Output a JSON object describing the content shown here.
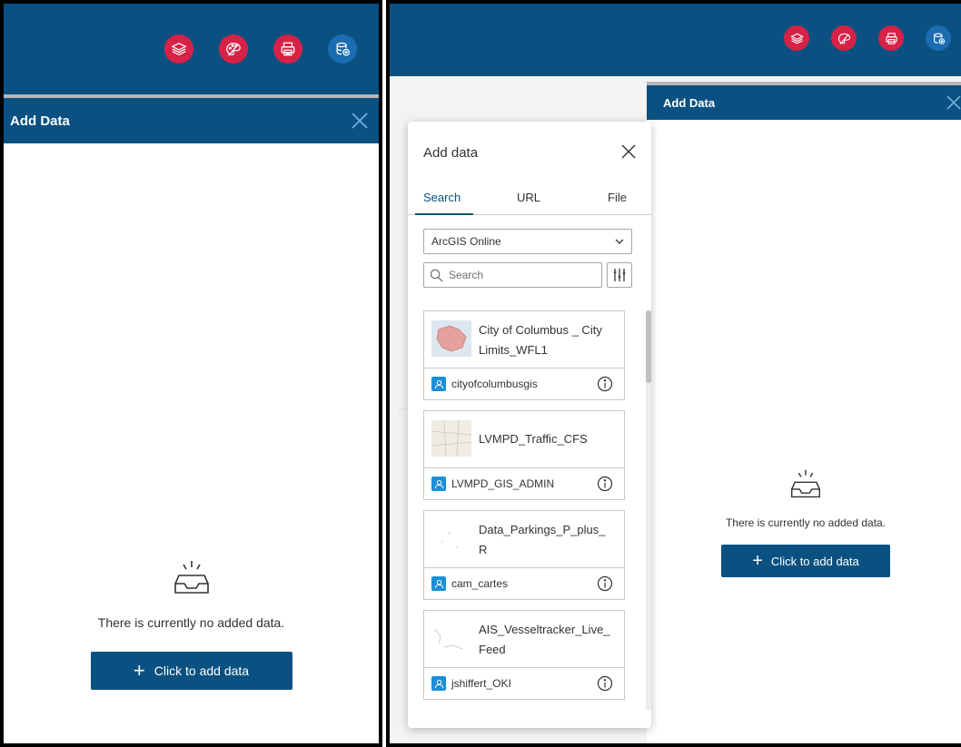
{
  "colors": {
    "header_blue": "#0a5181",
    "tool_red": "#d62246",
    "tool_blue": "#1a6db0",
    "owner_icon_blue": "#1a8fd8",
    "divider_gray": "#b7b7b7"
  },
  "toolbar": {
    "buttons": [
      {
        "icon": "layers-icon",
        "color": "red"
      },
      {
        "icon": "palette-icon",
        "color": "red"
      },
      {
        "icon": "print-icon",
        "color": "red"
      },
      {
        "icon": "add-data-icon",
        "color": "blue"
      }
    ]
  },
  "left_panel": {
    "widget_title": "Add Data",
    "empty_message": "There is currently no added data.",
    "add_button_label": "Click to add data"
  },
  "right_panel": {
    "widget_title": "Add Data",
    "empty_message": "There is currently no added data.",
    "add_button_label": "Click to add data"
  },
  "popup": {
    "title": "Add data",
    "tabs": [
      {
        "label": "Search",
        "active": true
      },
      {
        "label": "URL",
        "active": false
      },
      {
        "label": "File",
        "active": false
      }
    ],
    "source_selected": "ArcGIS Online",
    "search_placeholder": "Search",
    "results": [
      {
        "title": "City of Columbus _ City Limits_WFL1",
        "owner": "cityofcolumbusgis"
      },
      {
        "title": "LVMPD_Traffic_CFS",
        "owner": "LVMPD_GIS_ADMIN"
      },
      {
        "title": "Data_Parkings_P_plus_ R",
        "owner": "cam_cartes"
      },
      {
        "title": "AIS_Vesseltracker_Live_ Feed",
        "owner": "jshiffert_OKI"
      }
    ]
  }
}
